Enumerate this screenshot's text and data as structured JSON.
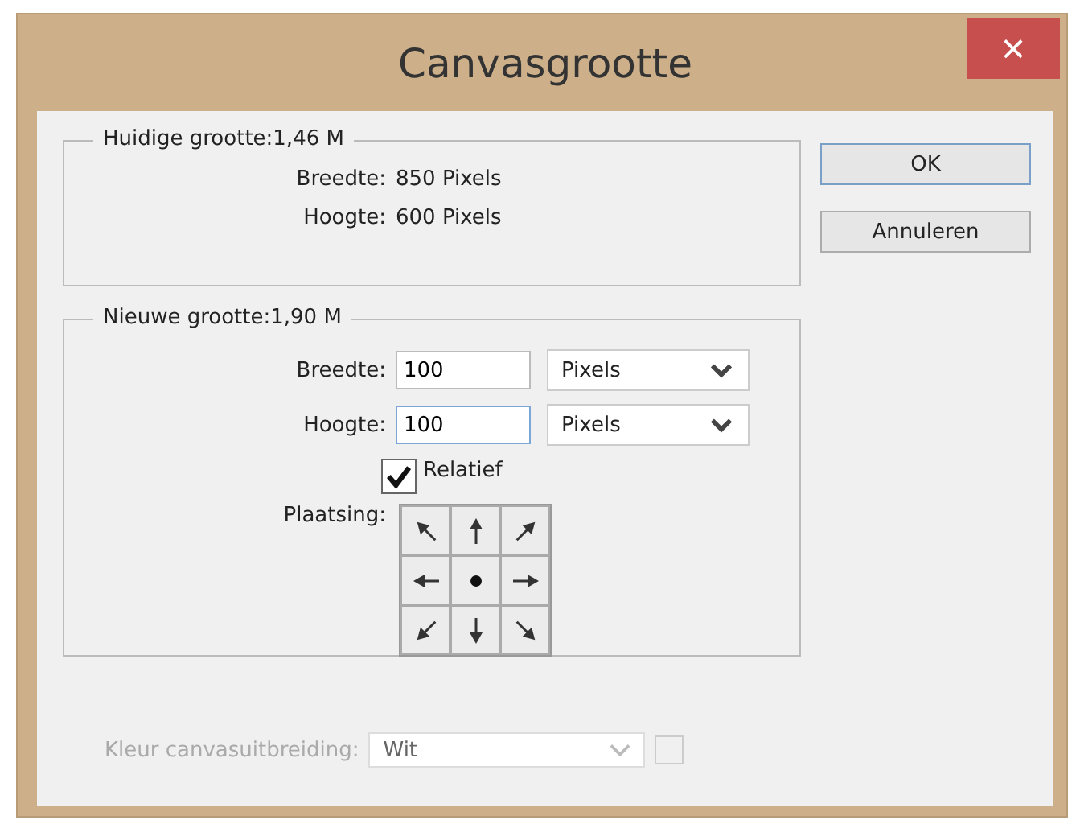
{
  "window": {
    "title": "Canvasgrootte",
    "close": "×"
  },
  "current_size": {
    "title": "Huidige grootte:1,46 M",
    "rows": [
      {
        "label": "Breedte:",
        "value": "850 Pixels"
      },
      {
        "label": "Hoogte:",
        "value": "600 Pixels"
      }
    ]
  },
  "new_size": {
    "title": "Nieuwe grootte:1,90 M",
    "fields": [
      {
        "label": "Breedte:",
        "value": "100",
        "unit": "Pixels",
        "focused": false
      },
      {
        "label": "Hoogte:",
        "value": "100",
        "unit": "Pixels",
        "focused": true
      }
    ],
    "relative": {
      "label": "Relatief",
      "checked": true
    },
    "placement": {
      "label": "Plaatsing:",
      "cells": [
        {
          "kind": "nw",
          "selected": false
        },
        {
          "kind": "n",
          "selected": false
        },
        {
          "kind": "ne",
          "selected": false
        },
        {
          "kind": "w",
          "selected": false
        },
        {
          "selected": true
        },
        {
          "kind": "e",
          "selected": false
        },
        {
          "kind": "sw",
          "selected": false
        },
        {
          "kind": "s",
          "selected": false
        },
        {
          "kind": "se",
          "selected": false
        }
      ]
    }
  },
  "extension_color": {
    "label": "Kleur canvasuitbreiding:",
    "value": "Wit",
    "disabled": true,
    "swatch_checked": false
  },
  "buttons": [
    {
      "label": "OK",
      "default": true
    },
    {
      "label": "Annuleren",
      "default": false
    }
  ]
}
